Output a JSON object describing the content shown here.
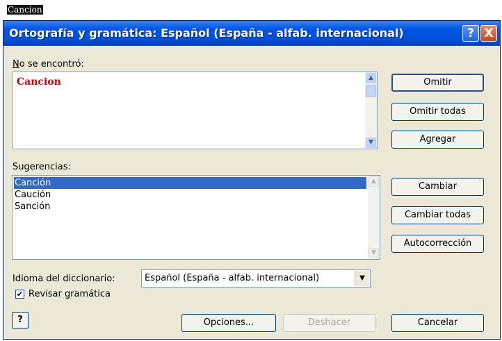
{
  "top_word": "Cancion",
  "window": {
    "title": "Ortografía y gramática: Español (España - alfab. internacional)",
    "help_symbol": "?",
    "close_symbol": "X"
  },
  "not_found": {
    "label": "No se encontró:",
    "word": "Cancion"
  },
  "suggestions": {
    "label": "Sugerencias:",
    "items": [
      "Canción",
      "Caución",
      "Sanción"
    ],
    "selected_index": 0
  },
  "dictionary": {
    "label": "Idioma del diccionario:",
    "value": "Español (España - alfab. internacional)"
  },
  "grammar_check": {
    "label": "Revisar gramática",
    "checked": true
  },
  "buttons": {
    "ignore": "Omitir",
    "ignore_all": "Omitir todas",
    "add": "Agregar",
    "change": "Cambiar",
    "change_all": "Cambiar todas",
    "autocorrect": "Autocorrección",
    "options": "Opciones...",
    "undo": "Deshacer",
    "cancel": "Cancelar"
  },
  "colors": {
    "misspelled_word": "#cc0000",
    "selection": "#316ac5",
    "titlebar": "#0054e3"
  },
  "icons": {
    "help": "help-icon",
    "close": "close-icon",
    "dropdown": "chevron-down-icon"
  }
}
